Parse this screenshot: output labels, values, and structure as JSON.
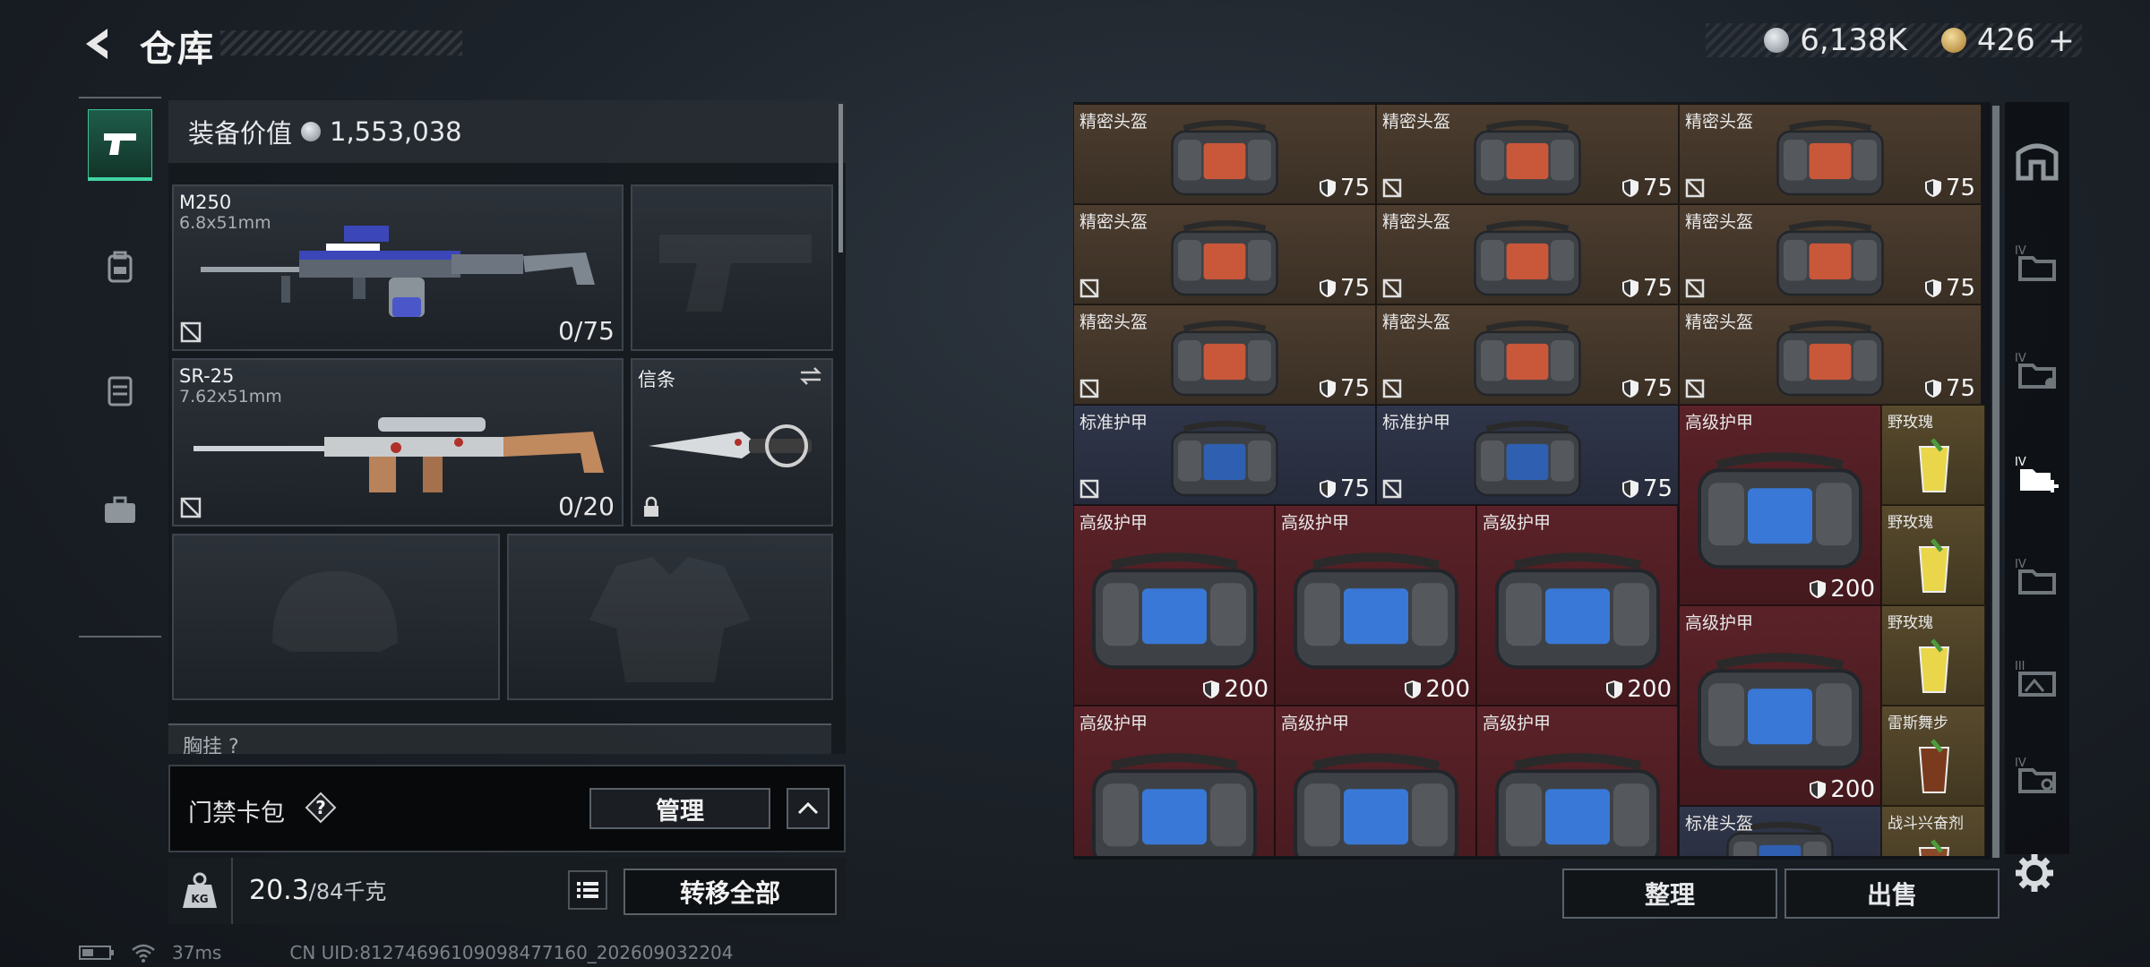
{
  "header": {
    "title": "仓库"
  },
  "currency": {
    "silver": "6,138K",
    "gold": "426",
    "gold_add": "+"
  },
  "left": {
    "equip_value_label": "装备价值",
    "equip_value": "1,553,038",
    "weapons": [
      {
        "name": "M250",
        "caliber": "6.8x51mm",
        "ammo": "0/75"
      },
      {
        "name": "SR-25",
        "caliber": "7.62x51mm",
        "ammo": "0/20"
      }
    ],
    "melee": {
      "name": "信条"
    },
    "chest_label": "胸挂 ?",
    "keycard": {
      "label": "门禁卡包",
      "help": "?",
      "manage": "管理"
    },
    "weight": {
      "current": "20.3",
      "max": "/84千克"
    },
    "transfer_all": "转移全部"
  },
  "status": {
    "ping": "37ms",
    "uid": "CN UID:8127469610909847716​0_202609032204"
  },
  "inventory": {
    "labels": {
      "precision_helmet": "精密头盔",
      "standard_armor": "标准护甲",
      "advanced_armor": "高级护甲",
      "rose": "野玫瑰",
      "race_dance": "雷斯舞步",
      "combat_stim": "战斗兴奋剂",
      "standard_helmet": "标准头盔"
    },
    "durability": {
      "d75": "75",
      "d200": "200"
    },
    "colors": {
      "helmet": "#4c3d2f",
      "standard": "#30364a",
      "advanced": "#5a2228"
    }
  },
  "actions": {
    "sort": "整理",
    "sell": "出售"
  }
}
